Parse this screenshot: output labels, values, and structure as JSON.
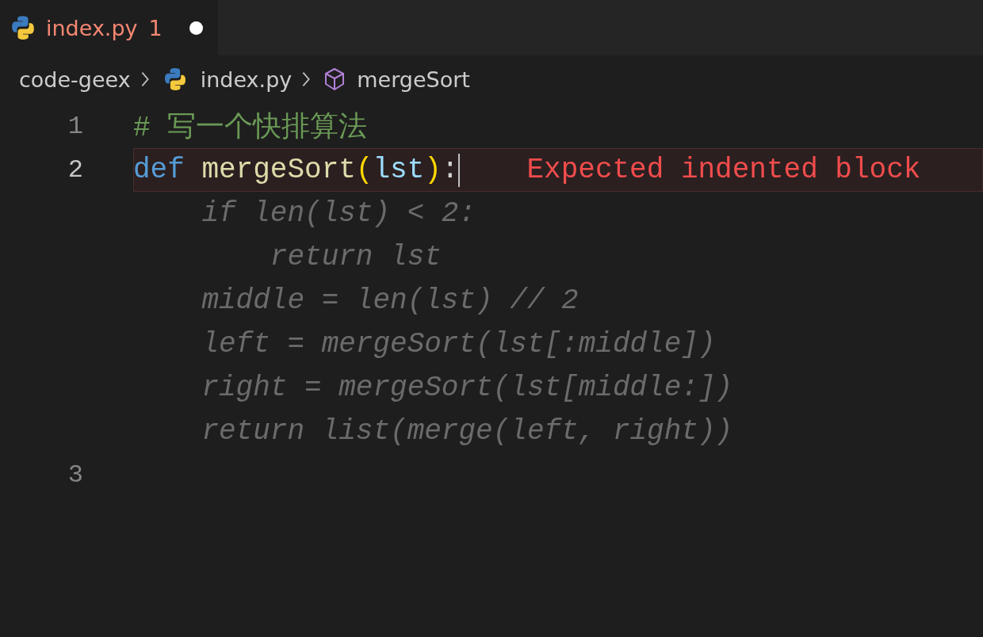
{
  "tab": {
    "label": "index.py",
    "problems": "1",
    "modified": true,
    "selected": true
  },
  "breadcrumb": [
    {
      "kind": "folder",
      "label": "code-geex"
    },
    {
      "kind": "python-file",
      "label": "index.py"
    },
    {
      "kind": "symbol",
      "label": "mergeSort"
    }
  ],
  "lines": [
    {
      "kind": "code",
      "number": "1",
      "active": false,
      "tokens": [
        {
          "kind": "comment",
          "text": "# 写一个快排算法"
        }
      ]
    },
    {
      "kind": "code",
      "number": "2",
      "active": true,
      "error_message": "Expected indented block",
      "tokens": [
        {
          "kind": "keyword",
          "text": "def"
        },
        {
          "kind": "function",
          "text": "mergeSort"
        },
        {
          "kind": "bracket",
          "text": "("
        },
        {
          "kind": "param",
          "text": "lst"
        },
        {
          "kind": "bracket",
          "text": ")"
        },
        {
          "kind": "plain",
          "text": ":"
        }
      ]
    },
    {
      "kind": "ghost",
      "text": "    if len(lst) < 2:"
    },
    {
      "kind": "ghost",
      "text": "        return lst"
    },
    {
      "kind": "ghost",
      "text": "    middle = len(lst) // 2"
    },
    {
      "kind": "ghost",
      "text": "    left = mergeSort(lst[:middle])"
    },
    {
      "kind": "ghost",
      "text": "    right = mergeSort(lst[middle:])"
    },
    {
      "kind": "ghost",
      "text": "    return list(merge(left, right))"
    },
    {
      "kind": "code",
      "number": "3",
      "active": false
    }
  ]
}
